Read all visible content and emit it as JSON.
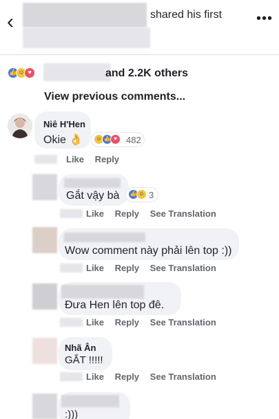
{
  "header": {
    "back_icon": "chevron-left-icon",
    "title_suffix": "shared his first",
    "more_icon": "more-dots-icon"
  },
  "reactions": {
    "icons": [
      "like-icon",
      "haha-icon",
      "love-icon"
    ],
    "text": "and 2.2K others"
  },
  "view_previous": "View previous comments...",
  "comments": [
    {
      "name": "Niê H'Hen",
      "text": "Okie 👌",
      "reaction_count": "482",
      "actions": {
        "like": "Like",
        "reply": "Reply"
      }
    },
    {
      "text": "Gắt vậy bà",
      "reaction_count": "3",
      "actions": {
        "like": "Like",
        "reply": "Reply",
        "translate": "See Translation"
      }
    },
    {
      "text": "Wow comment này phải lên top :))",
      "actions": {
        "like": "Like",
        "reply": "Reply",
        "translate": "See Translation"
      }
    },
    {
      "text": "Đưa Hen lên top đê.",
      "actions": {
        "like": "Like",
        "reply": "Reply",
        "translate": "See Translation"
      }
    },
    {
      "name": "Nhã Ân",
      "text": "GẮT !!!!!",
      "actions": {
        "like": "Like",
        "reply": "Reply",
        "translate": "See Translation"
      }
    },
    {
      "text": ":)))"
    }
  ],
  "colors": {
    "bubble": "#f1f2f5",
    "like": "#4a78e5",
    "haha": "#f4c543",
    "love": "#ee4f63",
    "meta_text": "#606770"
  }
}
